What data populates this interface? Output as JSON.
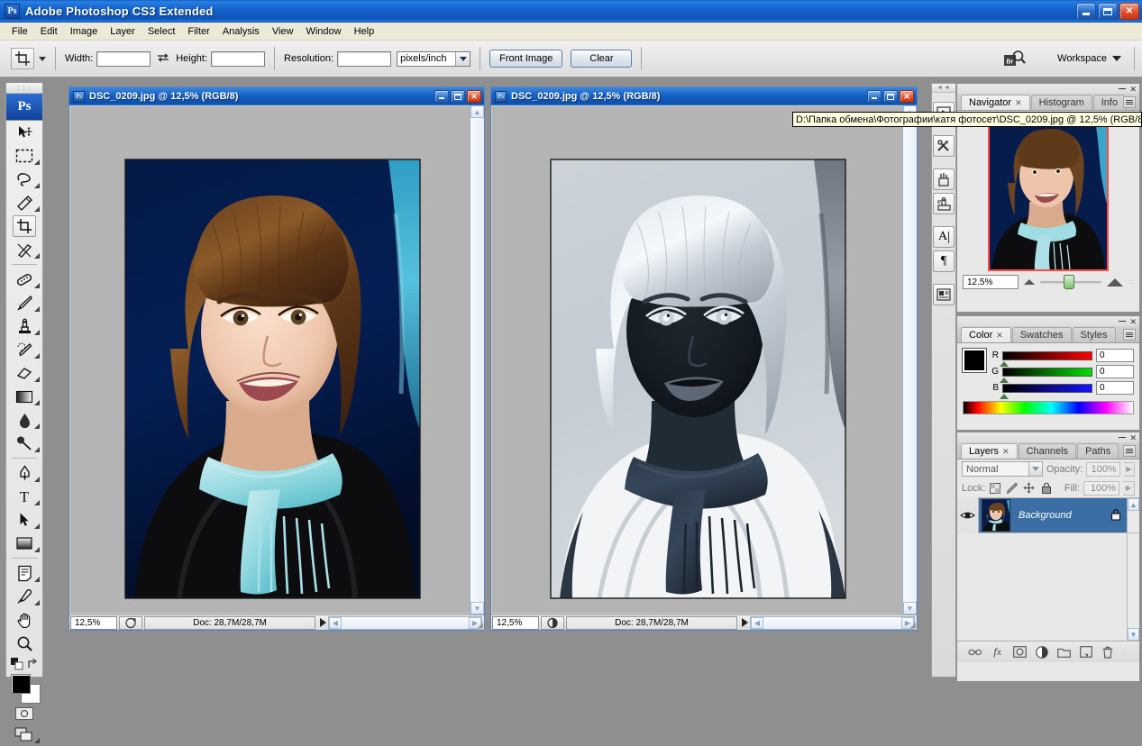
{
  "app": {
    "title": "Adobe Photoshop CS3 Extended",
    "logo_text": "Ps",
    "window_controls": {
      "minimize": "_",
      "maximize": "□",
      "close": "✕"
    }
  },
  "menu": {
    "items": [
      "File",
      "Edit",
      "Image",
      "Layer",
      "Select",
      "Filter",
      "Analysis",
      "View",
      "Window",
      "Help"
    ]
  },
  "options_bar": {
    "tool_icon": "crop-tool-icon",
    "width_label": "Width:",
    "width_value": "",
    "swap_icon": "swap-arrows-icon",
    "height_label": "Height:",
    "height_value": "",
    "resolution_label": "Resolution:",
    "resolution_value": "",
    "units_value": "pixels/inch",
    "front_image_label": "Front Image",
    "clear_label": "Clear",
    "bridge_icon": "bridge-icon",
    "bridge_badge": "Br",
    "workspace_label": "Workspace"
  },
  "toolbox": {
    "badge": "Ps",
    "tools": [
      {
        "name": "move-tool"
      },
      {
        "name": "rectangular-marquee-tool"
      },
      {
        "name": "lasso-tool"
      },
      {
        "name": "magic-wand-tool"
      },
      {
        "name": "crop-tool",
        "selected": true
      },
      {
        "name": "slice-tool"
      },
      {
        "name": "spot-healing-brush-tool"
      },
      {
        "name": "brush-tool"
      },
      {
        "name": "clone-stamp-tool"
      },
      {
        "name": "history-brush-tool"
      },
      {
        "name": "eraser-tool"
      },
      {
        "name": "gradient-tool"
      },
      {
        "name": "blur-tool"
      },
      {
        "name": "dodge-tool"
      },
      {
        "name": "pen-tool"
      },
      {
        "name": "horizontal-type-tool",
        "glyph": "T"
      },
      {
        "name": "path-selection-tool"
      },
      {
        "name": "rectangle-shape-tool"
      },
      {
        "name": "notes-tool"
      },
      {
        "name": "eyedropper-tool"
      },
      {
        "name": "hand-tool"
      },
      {
        "name": "zoom-tool"
      }
    ],
    "foreground_color": "#000000",
    "background_color": "#ffffff",
    "quick_mask_label": "quick-mask-mode",
    "screen_mode_label": "screen-mode"
  },
  "documents": [
    {
      "id": "doc-left",
      "title": "DSC_0209.jpg @ 12,5% (RGB/8)",
      "zoom": "12,5%",
      "doc_size": "Doc: 28,7M/28,7M",
      "variant": "color"
    },
    {
      "id": "doc-right",
      "title": "DSC_0209.jpg @ 12,5% (RGB/8)",
      "zoom": "12,5%",
      "doc_size": "Doc: 28,7M/28,7M",
      "variant": "inverted"
    }
  ],
  "tooltip": {
    "text": "D:\\Папка обмена\\Фотографии\\катя фотосет\\DSC_0209.jpg @ 12,5% (RGB/8)"
  },
  "dock_icons": [
    {
      "name": "animation-panel-icon"
    },
    {
      "name": "tool-presets-panel-icon"
    },
    {
      "name": "brushes-panel-icon"
    },
    {
      "name": "clone-source-panel-icon"
    },
    {
      "name": "character-panel-icon",
      "glyph": "A"
    },
    {
      "name": "paragraph-panel-icon",
      "glyph": "¶"
    },
    {
      "name": "layer-comps-panel-icon"
    }
  ],
  "navigator_panel": {
    "tabs": [
      {
        "label": "Navigator",
        "active": true,
        "closable": true
      },
      {
        "label": "Histogram",
        "active": false
      },
      {
        "label": "Info",
        "active": false
      }
    ],
    "zoom_value": "12.5%",
    "zoom_out_icon": "small-mountain-icon",
    "zoom_in_icon": "large-mountain-icon"
  },
  "color_panel": {
    "tabs": [
      {
        "label": "Color",
        "active": true,
        "closable": true
      },
      {
        "label": "Swatches",
        "active": false
      },
      {
        "label": "Styles",
        "active": false
      }
    ],
    "foreground": "#000000",
    "background": "#ffffff",
    "sliders": [
      {
        "label": "R",
        "value": "0"
      },
      {
        "label": "G",
        "value": "0"
      },
      {
        "label": "B",
        "value": "0"
      }
    ]
  },
  "layers_panel": {
    "tabs": [
      {
        "label": "Layers",
        "active": true,
        "closable": true
      },
      {
        "label": "Channels",
        "active": false
      },
      {
        "label": "Paths",
        "active": false
      }
    ],
    "blend_mode": "Normal",
    "opacity_label": "Opacity:",
    "opacity_value": "100%",
    "lock_label": "Lock:",
    "lock_icons": [
      "lock-transparent-pixels-icon",
      "lock-image-pixels-icon",
      "lock-position-icon",
      "lock-all-icon"
    ],
    "fill_label": "Fill:",
    "fill_value": "100%",
    "layers": [
      {
        "name": "Background",
        "visible": true,
        "locked": true
      }
    ],
    "bottom_icons": [
      {
        "name": "link-layers-icon"
      },
      {
        "name": "layer-style-fx-icon",
        "glyph": "fx"
      },
      {
        "name": "add-layer-mask-icon"
      },
      {
        "name": "new-adjustment-layer-icon"
      },
      {
        "name": "new-group-icon"
      },
      {
        "name": "new-layer-icon"
      },
      {
        "name": "delete-layer-icon"
      }
    ]
  }
}
